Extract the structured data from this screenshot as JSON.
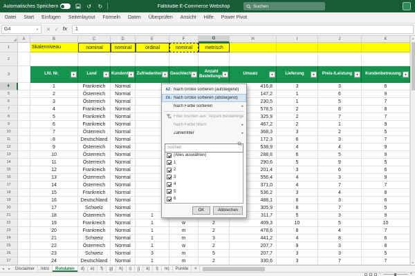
{
  "titlebar": {
    "autosave_label": "Automatisches Speichern",
    "title": "Fallstudie E-Commerce Webshop",
    "search_placeholder": "Suchen"
  },
  "menubar": {
    "tabs": [
      "Datei",
      "Start",
      "Einfügen",
      "Seitenlayout",
      "Formeln",
      "Daten",
      "Überprüfen",
      "Ansicht",
      "Hilfe",
      "Power Pivot"
    ]
  },
  "formula_bar": {
    "name_box": "G4",
    "fx_label": "fx",
    "value": "1"
  },
  "grid": {
    "column_letters": [
      "A",
      "B",
      "C",
      "D",
      "E",
      "F",
      "G",
      "H",
      "I",
      "J",
      "K"
    ],
    "selected_column": "G",
    "selected_row_number": 4,
    "scale_row": {
      "label": "Skalenniveau",
      "values": [
        "nominal",
        "nominal",
        "ordinal",
        "nominal",
        "metrisch"
      ]
    },
    "headers": [
      "Lfd. Nr.",
      "Land",
      "Kundentyp",
      "Zufriedenheit",
      "Geschlecht",
      "Anzahl Bestellungen",
      "Umsatz",
      "Lieferung",
      "Preis-/Leistung",
      "Kundenbetreuung"
    ],
    "rows": [
      {
        "nr": "1",
        "land": "Frankreich",
        "kundentyp": "Normal",
        "zufriedenheit": "",
        "geschlecht": "",
        "bestellungen": "",
        "umsatz": "416,8",
        "lieferung": "3",
        "preis_leistung": "3",
        "kundenbetreuung": "6"
      },
      {
        "nr": "2",
        "land": "Österreich",
        "kundentyp": "Normal",
        "zufriedenheit": "",
        "geschlecht": "",
        "bestellungen": "",
        "umsatz": "147,2",
        "lieferung": "1",
        "preis_leistung": "6",
        "kundenbetreuung": "9"
      },
      {
        "nr": "3",
        "land": "Österreich",
        "kundentyp": "Normal",
        "zufriedenheit": "",
        "geschlecht": "",
        "bestellungen": "",
        "umsatz": "230,5",
        "lieferung": "1",
        "preis_leistung": "5",
        "kundenbetreuung": "7"
      },
      {
        "nr": "4",
        "land": "Frankreich",
        "kundentyp": "Normal",
        "zufriedenheit": "",
        "geschlecht": "",
        "bestellungen": "",
        "umsatz": "578,5",
        "lieferung": "2",
        "preis_leistung": "8",
        "kundenbetreuung": "8"
      },
      {
        "nr": "5",
        "land": "Frankreich",
        "kundentyp": "Normal",
        "zufriedenheit": "",
        "geschlecht": "",
        "bestellungen": "",
        "umsatz": "325,9",
        "lieferung": "2",
        "preis_leistung": "7",
        "kundenbetreuung": "7"
      },
      {
        "nr": "6",
        "land": "Frankreich",
        "kundentyp": "Normal",
        "zufriedenheit": "",
        "geschlecht": "",
        "bestellungen": "",
        "umsatz": "467,2",
        "lieferung": "2",
        "preis_leistung": "1",
        "kundenbetreuung": "9"
      },
      {
        "nr": "7",
        "land": "Österreich",
        "kundentyp": "Normal",
        "zufriedenheit": "",
        "geschlecht": "",
        "bestellungen": "",
        "umsatz": "368,3",
        "lieferung": "3",
        "preis_leistung": "2",
        "kundenbetreuung": "5"
      },
      {
        "nr": "8",
        "land": "Deutschland",
        "kundentyp": "Normal",
        "zufriedenheit": "",
        "geschlecht": "",
        "bestellungen": "",
        "umsatz": "172,3",
        "lieferung": "6",
        "preis_leistung": "3",
        "kundenbetreuung": "7"
      },
      {
        "nr": "9",
        "land": "Österreich",
        "kundentyp": "Normal",
        "zufriedenheit": "",
        "geschlecht": "",
        "bestellungen": "",
        "umsatz": "538,9",
        "lieferung": "4",
        "preis_leistung": "4",
        "kundenbetreuung": "9"
      },
      {
        "nr": "10",
        "land": "Österreich",
        "kundentyp": "Normal",
        "zufriedenheit": "",
        "geschlecht": "",
        "bestellungen": "",
        "umsatz": "288,6",
        "lieferung": "6",
        "preis_leistung": "5",
        "kundenbetreuung": "9"
      },
      {
        "nr": "11",
        "land": "Österreich",
        "kundentyp": "Normal",
        "zufriedenheit": "",
        "geschlecht": "",
        "bestellungen": "",
        "umsatz": "290,6",
        "lieferung": "5",
        "preis_leistung": "9",
        "kundenbetreuung": "5"
      },
      {
        "nr": "12",
        "land": "Frankreich",
        "kundentyp": "Normal",
        "zufriedenheit": "",
        "geschlecht": "",
        "bestellungen": "",
        "umsatz": "201,4",
        "lieferung": "3",
        "preis_leistung": "6",
        "kundenbetreuung": "6"
      },
      {
        "nr": "13",
        "land": "Österreich",
        "kundentyp": "Normal",
        "zufriedenheit": "",
        "geschlecht": "",
        "bestellungen": "",
        "umsatz": "556,4",
        "lieferung": "4",
        "preis_leistung": "3",
        "kundenbetreuung": "9"
      },
      {
        "nr": "14",
        "land": "Österreich",
        "kundentyp": "Normal",
        "zufriedenheit": "",
        "geschlecht": "",
        "bestellungen": "",
        "umsatz": "371,0",
        "lieferung": "4",
        "preis_leistung": "7",
        "kundenbetreuung": "7"
      },
      {
        "nr": "15",
        "land": "Frankreich",
        "kundentyp": "Normal",
        "zufriedenheit": "",
        "geschlecht": "",
        "bestellungen": "",
        "umsatz": "536,2",
        "lieferung": "3",
        "preis_leistung": "4",
        "kundenbetreuung": "8"
      },
      {
        "nr": "16",
        "land": "Deutschland",
        "kundentyp": "Normal",
        "zufriedenheit": "",
        "geschlecht": "",
        "bestellungen": "",
        "umsatz": "488,1",
        "lieferung": "8",
        "preis_leistung": "3",
        "kundenbetreuung": "6"
      },
      {
        "nr": "17",
        "land": "Schweiz",
        "kundentyp": "Normal",
        "zufriedenheit": "",
        "geschlecht": "",
        "bestellungen": "",
        "umsatz": "305,9",
        "lieferung": "8",
        "preis_leistung": "7",
        "kundenbetreuung": "5"
      },
      {
        "nr": "18",
        "land": "Österreich",
        "kundentyp": "Normal",
        "zufriedenheit": "1",
        "geschlecht": "",
        "bestellungen": "",
        "umsatz": "311,7",
        "lieferung": "5",
        "preis_leistung": "3",
        "kundenbetreuung": "9"
      },
      {
        "nr": "19",
        "land": "Frankreich",
        "kundentyp": "Normal",
        "zufriedenheit": "1",
        "geschlecht": "w",
        "bestellungen": "2",
        "umsatz": "409,3",
        "lieferung": "10",
        "preis_leistung": "5",
        "kundenbetreuung": "10"
      },
      {
        "nr": "20",
        "land": "Frankreich",
        "kundentyp": "Normal",
        "zufriedenheit": "1",
        "geschlecht": "m",
        "bestellungen": "2",
        "umsatz": "478,6",
        "lieferung": "8",
        "preis_leistung": "4",
        "kundenbetreuung": "7"
      },
      {
        "nr": "21",
        "land": "Schweiz",
        "kundentyp": "Normal",
        "zufriedenheit": "1",
        "geschlecht": "m",
        "bestellungen": "3",
        "umsatz": "441,2",
        "lieferung": "4",
        "preis_leistung": "8",
        "kundenbetreuung": "6"
      },
      {
        "nr": "22",
        "land": "Österreich",
        "kundentyp": "Normal",
        "zufriedenheit": "1",
        "geschlecht": "w",
        "bestellungen": "2",
        "umsatz": "207,7",
        "lieferung": "9",
        "preis_leistung": "3",
        "kundenbetreuung": "8"
      },
      {
        "nr": "23",
        "land": "Schweiz",
        "kundentyp": "Normal",
        "zufriedenheit": "3",
        "geschlecht": "m",
        "bestellungen": "5",
        "umsatz": "207,7",
        "lieferung": "3",
        "preis_leistung": "3",
        "kundenbetreuung": "5"
      },
      {
        "nr": "24",
        "land": "Deutschland",
        "kundentyp": "Normal",
        "zufriedenheit": "1",
        "geschlecht": "m",
        "bestellungen": "2",
        "umsatz": "330,6",
        "lieferung": "3",
        "preis_leistung": "7",
        "kundenbetreuung": "7"
      }
    ]
  },
  "filter_menu": {
    "sort_asc": "Nach Größe sortieren (aufsteigend)",
    "sort_desc": "Nach Größe sortieren (absteigend)",
    "sort_color": "Nach Farbe sortieren",
    "clear_filter": "Filter löschen aus \"Anzahl Bestellungen\"",
    "filter_color": "Nach Farbe filtern",
    "number_filters": "Zahlenfilter",
    "search_placeholder": "Suchen",
    "checkbox_items": [
      {
        "label": "(Alles auswählen)",
        "checked": true
      },
      {
        "label": "1",
        "checked": true
      },
      {
        "label": "2",
        "checked": true
      },
      {
        "label": "3",
        "checked": true
      },
      {
        "label": "4",
        "checked": true
      },
      {
        "label": "5",
        "checked": true
      },
      {
        "label": "6",
        "checked": true
      }
    ],
    "ok_label": "OK",
    "cancel_label": "Abbrechen"
  },
  "sheet_tabs": {
    "tabs": [
      "Disclaimer",
      "Intro",
      "Rohdaten",
      "d)",
      "e)",
      "f)",
      "g)",
      "h)",
      "i)",
      "j)",
      "k)",
      "l)",
      "m)",
      "Punkte"
    ],
    "active": "Rohdaten"
  },
  "icons": {
    "dropdown": "▼",
    "submenu": "▸",
    "sort_asc": "AZ↓",
    "sort_desc": "ZA↓",
    "undo": "↺",
    "redo": "↻",
    "cancel": "✕",
    "enter": "✓",
    "namebox_dropdown": "▼",
    "scroll_up": "▲",
    "scroll_down": "▼",
    "tab_prev": "◂",
    "tab_next": "▸",
    "add_sheet": "+",
    "zoom_out": "−",
    "zoom_in": "+"
  },
  "colors": {
    "titlebar_green": "#185c37",
    "table_header_green": "#16934e",
    "accent_green": "#217346",
    "scale_row_yellow": "#ffff00"
  }
}
